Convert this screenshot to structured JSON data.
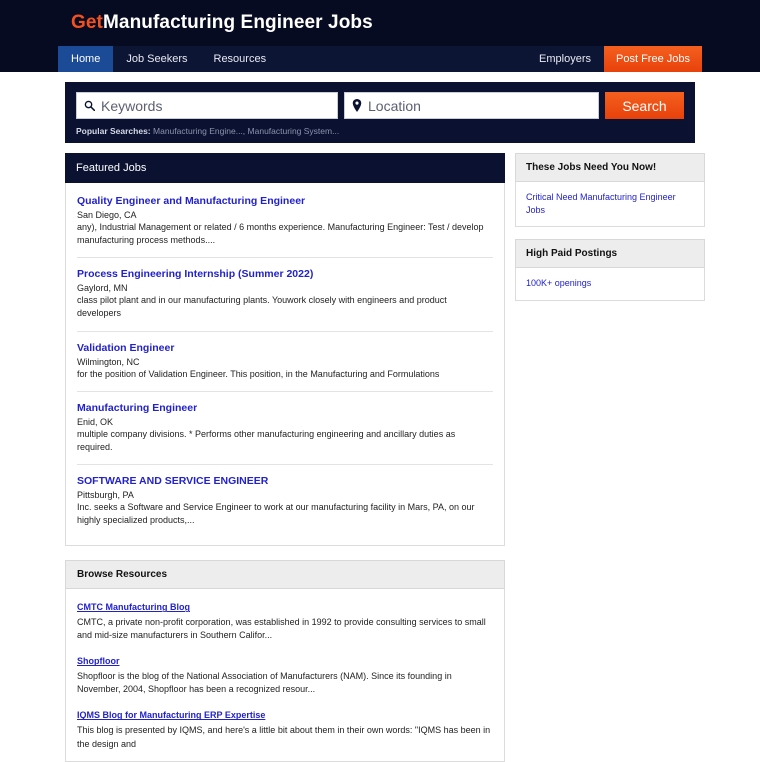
{
  "header": {
    "logo_accent": "Get",
    "logo_rest": "Manufacturing Engineer Jobs",
    "accent_color": "#f4511e"
  },
  "nav": {
    "items": [
      {
        "label": "Home",
        "active": true
      },
      {
        "label": "Job Seekers",
        "active": false
      },
      {
        "label": "Resources",
        "active": false
      }
    ],
    "right_items": [
      {
        "label": "Employers",
        "cta": false
      },
      {
        "label": "Post Free Jobs",
        "cta": true
      }
    ]
  },
  "search": {
    "keywords_placeholder": "Keywords",
    "location_placeholder": "Location",
    "keywords_value": "",
    "location_value": "",
    "button_label": "Search",
    "popular_label": "Popular Searches:",
    "popular_items": [
      "Manufacturing Engine...",
      "Manufacturing System..."
    ],
    "popular_separator": ", "
  },
  "featured": {
    "title": "Featured Jobs",
    "jobs": [
      {
        "title": "Quality Engineer and Manufacturing Engineer",
        "location": "San Diego, CA",
        "description": "any), Industrial Management or related / 6 months experience. Manufacturing Engineer: Test / develop manufacturing process methods...."
      },
      {
        "title": "Process Engineering Internship (Summer 2022)",
        "location": "Gaylord, MN",
        "description": "class pilot plant and in our manufacturing plants. Youwork closely with engineers and product developers"
      },
      {
        "title": "Validation Engineer",
        "location": "Wilmington, NC",
        "description": "for the position of Validation Engineer. This position, in the Manufacturing and Formulations"
      },
      {
        "title": "Manufacturing Engineer",
        "location": "Enid, OK",
        "description": "multiple company divisions. * Performs other manufacturing engineering and ancillary duties as required."
      },
      {
        "title": "SOFTWARE AND SERVICE ENGINEER",
        "location": "Pittsburgh, PA",
        "description": "Inc. seeks a Software and Service Engineer to work at our manufacturing facility in Mars, PA, on our highly specialized products,..."
      }
    ]
  },
  "resources": {
    "title": "Browse Resources",
    "items": [
      {
        "link": "CMTC Manufacturing Blog",
        "description": "CMTC, a private non-profit corporation, was established in 1992 to provide consulting services to small and mid-size manufacturers in Southern Califor..."
      },
      {
        "link": "Shopfloor",
        "description": "Shopfloor is the blog of the National Association of Manufacturers (NAM). Since its founding in November, 2004, Shopfloor has been a recognized resour..."
      },
      {
        "link": "IQMS Blog for Manufacturing ERP Expertise",
        "description": "This blog is presented by IQMS, and here's a little bit about them in their own words: \"IQMS has been in the design and"
      }
    ]
  },
  "sidebar": {
    "widgets": [
      {
        "title": "These Jobs Need You Now!",
        "link": "Critical Need Manufacturing Engineer Jobs"
      },
      {
        "title": "High Paid Postings",
        "link": "100K+ openings"
      }
    ]
  }
}
